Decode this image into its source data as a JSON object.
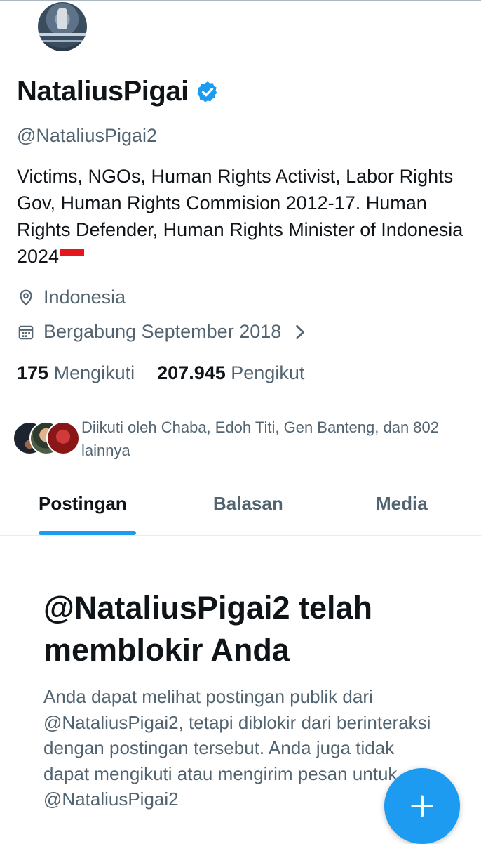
{
  "profile": {
    "name": "NataliusPigai",
    "handle": "@NataliusPigai2",
    "bio": "Victims, NGOs, Human Rights Activist, Labor Rights Gov, Human Rights Commision 2012-17. Human Rights Defender, Human Rights Minister of Indonesia 2024",
    "location": "Indonesia",
    "joined": "Bergabung September 2018",
    "following_count": "175",
    "following_label": "Mengikuti",
    "followers_count": "207.945",
    "followers_label": "Pengikut",
    "followed_by": "Diikuti oleh Chaba, Edoh Titi, Gen Banteng, dan 802 lainnya"
  },
  "tabs": [
    {
      "label": "Postingan",
      "active": true
    },
    {
      "label": "Balasan",
      "active": false
    },
    {
      "label": "Media",
      "active": false
    }
  ],
  "blocked": {
    "title": "@NataliusPigai2 telah memblokir Anda",
    "text": "Anda dapat melihat postingan publik dari @NataliusPigai2, tetapi diblokir dari berinteraksi dengan postingan tersebut. Anda juga tidak dapat mengikuti atau mengirim pesan untuk @NataliusPigai2"
  },
  "colors": {
    "accent": "#1d9bf0",
    "text_primary": "#0f1419",
    "text_secondary": "#536471"
  },
  "icons": {
    "verified": "verified-badge-icon",
    "location": "location-pin-icon",
    "calendar": "calendar-icon",
    "chevron": "chevron-right-icon",
    "fab": "plus-icon"
  }
}
